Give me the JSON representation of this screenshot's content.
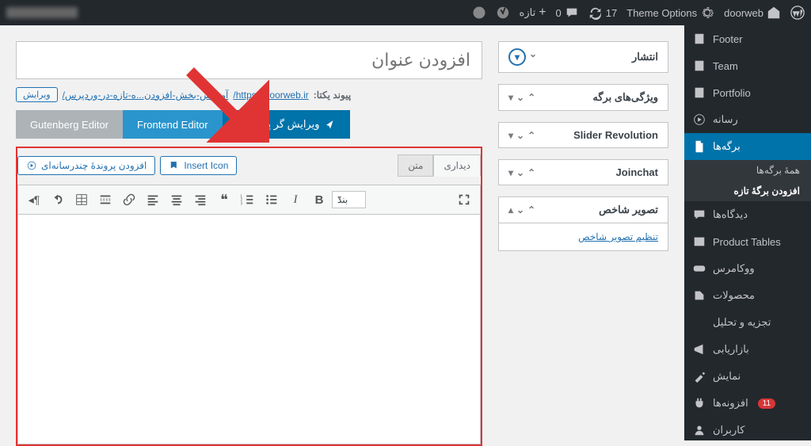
{
  "adminbar": {
    "theme_options": "Theme Options",
    "username": "doorweb",
    "comments": "0",
    "new": "تازه",
    "updates": "17"
  },
  "sidebar": {
    "items": [
      {
        "label": "Footer",
        "icon": "page"
      },
      {
        "label": "Team",
        "icon": "page"
      },
      {
        "label": "Portfolio",
        "icon": "page"
      },
      {
        "label": "رسانه",
        "icon": "media"
      },
      {
        "label": "برگه‌ها",
        "icon": "page",
        "current": true
      },
      {
        "label": "دیدگاه‌ها",
        "icon": "comments"
      },
      {
        "label": "Product Tables",
        "icon": "table"
      },
      {
        "label": "ووکامرس",
        "icon": "woo"
      },
      {
        "label": "محصولات",
        "icon": "product"
      },
      {
        "label": "تجزیه و تحلیل",
        "icon": "analytics"
      },
      {
        "label": "بازاریابی",
        "icon": "marketing"
      },
      {
        "label": "نمایش",
        "icon": "appearance"
      },
      {
        "label": "افزونه‌ها",
        "icon": "plugins",
        "badge": "11"
      },
      {
        "label": "کاربران",
        "icon": "users"
      }
    ],
    "submenu": {
      "all": "همهٔ برگه‌ها",
      "add": "افزودن برگهٔ تازه"
    }
  },
  "editor": {
    "title_placeholder": "افزودن عنوان",
    "permalink_label": "پیوند یکتا:",
    "permalink_base": "https://doorweb.ir/",
    "permalink_slug": "آموزش-بخش-افزودن...ه-تازه-در-وردپرس/",
    "permalink_edit": "ویرایش",
    "tabs": {
      "advanced": "ویرایش گر پیشرفته",
      "frontend": "Frontend Editor",
      "gutenberg": "Gutenberg Editor"
    },
    "add_media": "افزودن پروندهٔ چندرسانه‌ای",
    "insert_icon": "Insert Icon",
    "tab_visual": "دیداری",
    "tab_text": "متن",
    "format_label": "بند"
  },
  "metaboxes": {
    "publish": "انتشار",
    "page_attrs": "ویژگی‌های برگه",
    "slider_rev": "Slider Revolution",
    "joinchat": "Joinchat",
    "featured_img": "تصویر شاخص",
    "set_featured": "تنظیم تصویر شاخص"
  }
}
